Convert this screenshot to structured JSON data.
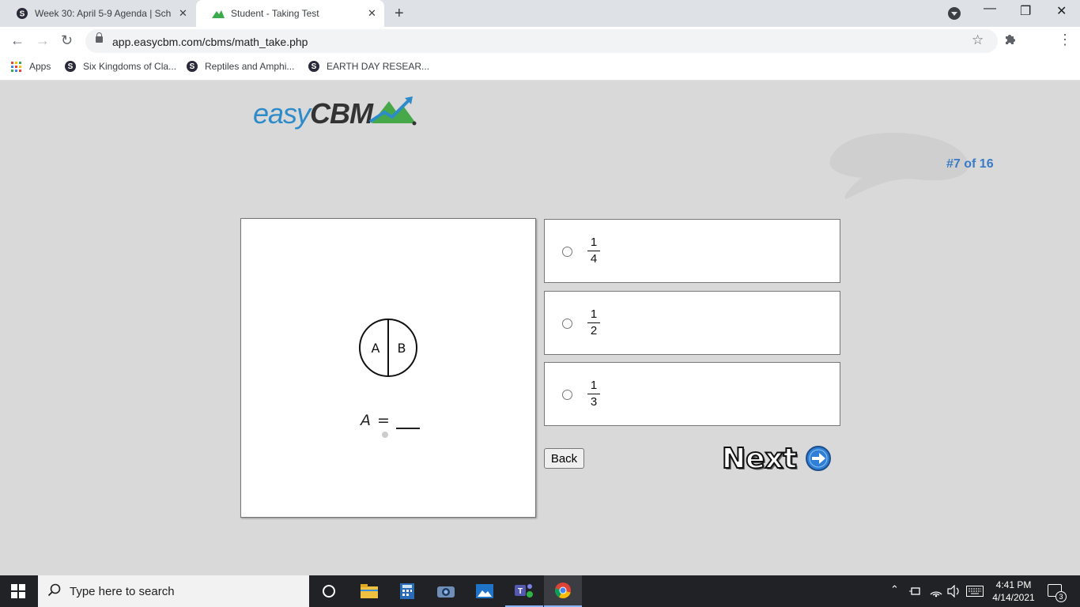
{
  "browser": {
    "tabs": [
      {
        "title": "Week 30: April 5-9 Agenda | Sch",
        "favicon": "s-circle-icon"
      },
      {
        "title": "Student - Taking Test",
        "favicon": "easycbm-icon"
      }
    ],
    "close_glyph": "✕",
    "new_tab_glyph": "+",
    "url": "app.easycbm.com/cbms/math_take.php",
    "bookmarks": [
      {
        "label": "Apps",
        "icon": "apps-grid-icon"
      },
      {
        "label": "Six Kingdoms of Cla...",
        "icon": "s-circle-icon"
      },
      {
        "label": "Reptiles and Amphi...",
        "icon": "s-circle-icon"
      },
      {
        "label": "EARTH DAY RESEAR...",
        "icon": "s-circle-icon"
      }
    ]
  },
  "app": {
    "logo": {
      "part1": "easy",
      "part2": "CBM",
      "mark": "."
    },
    "question_counter": "#7 of 16",
    "accent_color": "#3a7bc8",
    "question": {
      "circle_labels": [
        "A",
        "B"
      ],
      "equation_variable": "A",
      "equation_sign": "="
    },
    "choices": [
      {
        "numerator": "1",
        "denominator": "4"
      },
      {
        "numerator": "1",
        "denominator": "2"
      },
      {
        "numerator": "1",
        "denominator": "3"
      }
    ],
    "back_label": "Back",
    "next_label": "Next"
  },
  "taskbar": {
    "search_placeholder": "Type here to search",
    "time": "4:41 PM",
    "date": "4/14/2021",
    "notification_count": "3",
    "apps": [
      "cortana-icon",
      "file-explorer-icon",
      "calculator-icon",
      "camera-icon",
      "photos-icon",
      "teams-icon",
      "chrome-icon"
    ]
  }
}
